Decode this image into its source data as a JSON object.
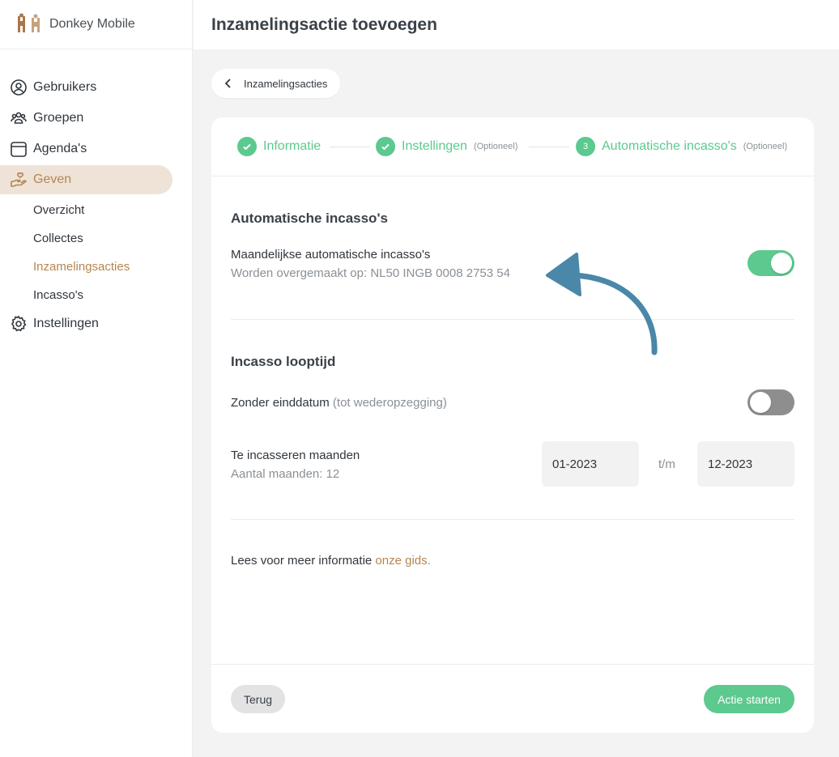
{
  "app": {
    "name": "Donkey Mobile"
  },
  "header": {
    "title": "Inzamelingsactie toevoegen"
  },
  "sidebar": {
    "items": [
      {
        "label": "Gebruikers",
        "icon": "user-circle-icon"
      },
      {
        "label": "Groepen",
        "icon": "users-icon"
      },
      {
        "label": "Agenda's",
        "icon": "calendar-icon"
      },
      {
        "label": "Geven",
        "icon": "hand-heart-icon",
        "active": true
      },
      {
        "label": "Instellingen",
        "icon": "gear-icon"
      }
    ],
    "subitems": [
      {
        "label": "Overzicht"
      },
      {
        "label": "Collectes"
      },
      {
        "label": "Inzamelingsacties",
        "active": true
      },
      {
        "label": "Incasso's"
      }
    ]
  },
  "breadcrumb": {
    "back_label": "Inzamelingsacties"
  },
  "steps": [
    {
      "label": "Informatie",
      "optional": ""
    },
    {
      "label": "Instellingen",
      "optional": "(Optioneel)"
    },
    {
      "number": "3",
      "label": "Automatische incasso's",
      "optional": "(Optioneel)"
    }
  ],
  "section_incasso": {
    "title": "Automatische incasso's",
    "monthly_label": "Maandelijkse automatische incasso's",
    "monthly_sub": "Worden overgemaakt op: NL50 INGB 0008 2753 54",
    "monthly_enabled": true
  },
  "section_looptijd": {
    "title": "Incasso looptijd",
    "no_end_label": "Zonder einddatum",
    "no_end_hint": "(tot wederopzegging)",
    "no_end_enabled": false,
    "months_label": "Te incasseren maanden",
    "months_count": "Aantal maanden: 12",
    "from_value": "01-2023",
    "separator": "t/m",
    "to_value": "12-2023"
  },
  "info": {
    "text": "Lees voor meer informatie ",
    "link": "onze gids."
  },
  "footer": {
    "back_label": "Terug",
    "start_label": "Actie starten"
  },
  "colors": {
    "accent_green": "#5cc98e",
    "accent_brown": "#b38652",
    "arrow_blue": "#4a87a8"
  }
}
